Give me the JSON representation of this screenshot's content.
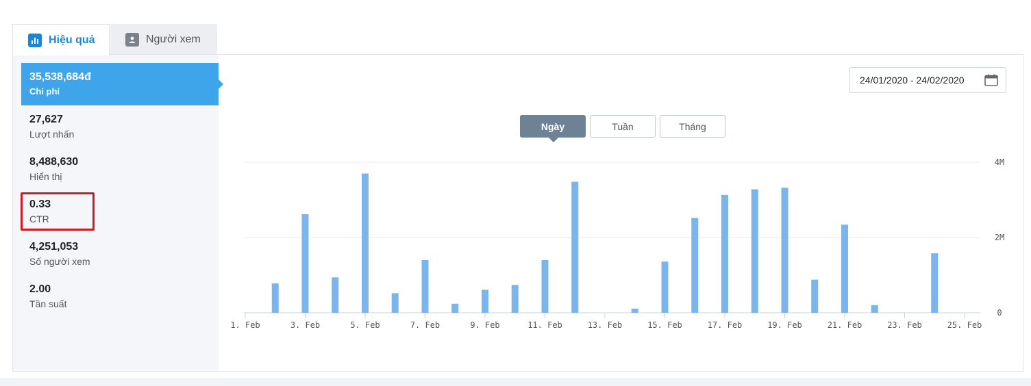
{
  "tabs": [
    {
      "label": "Hiệu quả",
      "icon": "bar-chart-icon",
      "active": true
    },
    {
      "label": "Người xem",
      "icon": "user-card-icon",
      "active": false
    }
  ],
  "metrics": [
    {
      "value": "35,538,684đ",
      "label": "Chi phí",
      "active": true
    },
    {
      "value": "27,627",
      "label": "Lượt nhấn",
      "active": false
    },
    {
      "value": "8,488,630",
      "label": "Hiển thị",
      "active": false
    },
    {
      "value": "0.33",
      "label": "CTR",
      "active": false
    },
    {
      "value": "4,251,053",
      "label": "Số người xem",
      "active": false
    },
    {
      "value": "2.00",
      "label": "Tần suất",
      "active": false
    }
  ],
  "date_range": {
    "text": "24/01/2020 - 24/02/2020",
    "icon": "calendar-icon"
  },
  "granularity": {
    "options": [
      "Ngày",
      "Tuần",
      "Tháng"
    ],
    "selected": "Ngày"
  },
  "colors": {
    "accent": "#1b86d8",
    "active_metric": "#3fa5eb",
    "bar": "#7cb5ec",
    "highlight": "#d6181c",
    "granularity_active": "#6e8296"
  },
  "chart_data": {
    "type": "bar",
    "x_tick_labels": [
      "1. Feb",
      "3. Feb",
      "5. Feb",
      "7. Feb",
      "9. Feb",
      "11. Feb",
      "13. Feb",
      "15. Feb",
      "17. Feb",
      "19. Feb",
      "21. Feb",
      "23. Feb",
      "25. Feb"
    ],
    "y_tick_labels": [
      "0",
      "2M",
      "4M"
    ],
    "ylim": [
      0,
      4000000
    ],
    "grid": true,
    "y_axis_side": "right",
    "series": [
      {
        "days": [
          1,
          2,
          3,
          4,
          5,
          6,
          7,
          8,
          9,
          10,
          11,
          12,
          13,
          14,
          15,
          16,
          17,
          18,
          19,
          20,
          21,
          22,
          23,
          24
        ],
        "values": [
          0,
          780000,
          2620000,
          940000,
          3700000,
          520000,
          1400000,
          240000,
          610000,
          740000,
          1400000,
          3480000,
          0,
          110000,
          1360000,
          2520000,
          3130000,
          3280000,
          3320000,
          880000,
          2340000,
          200000,
          0,
          1580000
        ]
      }
    ]
  }
}
